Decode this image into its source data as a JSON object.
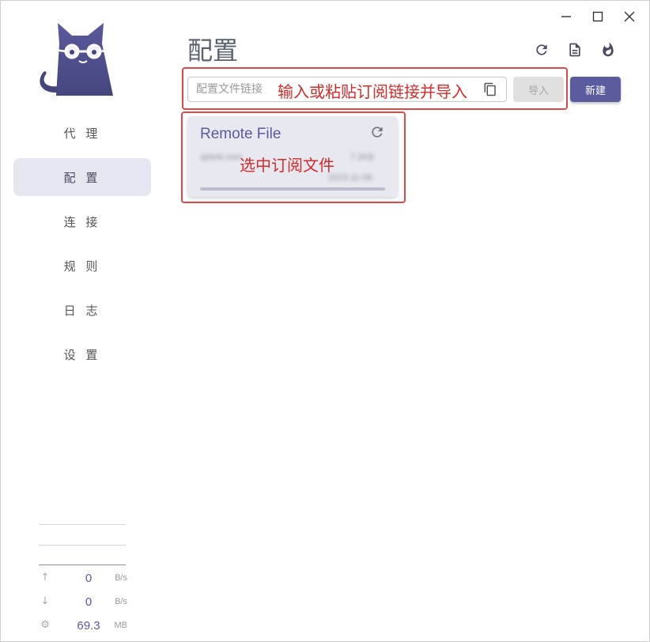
{
  "window_controls": {
    "minimize": "minimize",
    "maximize": "maximize",
    "close": "close"
  },
  "sidebar": {
    "items": [
      {
        "label": "代 理",
        "active": false
      },
      {
        "label": "配 置",
        "active": true
      },
      {
        "label": "连 接",
        "active": false
      },
      {
        "label": "规 则",
        "active": false
      },
      {
        "label": "日 志",
        "active": false
      },
      {
        "label": "设 置",
        "active": false
      }
    ],
    "stats": {
      "upload": {
        "value": "0",
        "unit": "B/s"
      },
      "download": {
        "value": "0",
        "unit": "B/s"
      },
      "memory": {
        "value": "69.3",
        "unit": "MB"
      }
    }
  },
  "header": {
    "title": "配置",
    "icons": [
      "refresh-icon",
      "document-icon",
      "flame-icon"
    ]
  },
  "import_bar": {
    "placeholder": "配置文件链接",
    "import_label": "导入",
    "new_label": "新建"
  },
  "profile_card": {
    "name": "Remote File",
    "blurred_host": "sjrbnk.com",
    "blurred_size": "7.2KB",
    "blurred_date": "2023-11-08",
    "progress": 1.0
  },
  "annotations": {
    "import_hint": "输入或粘贴订阅链接并导入",
    "select_hint": "选中订阅文件"
  },
  "colors": {
    "accent": "#5b5b9f",
    "annotation": "#e04848",
    "active_nav": "#e6e6f0"
  }
}
